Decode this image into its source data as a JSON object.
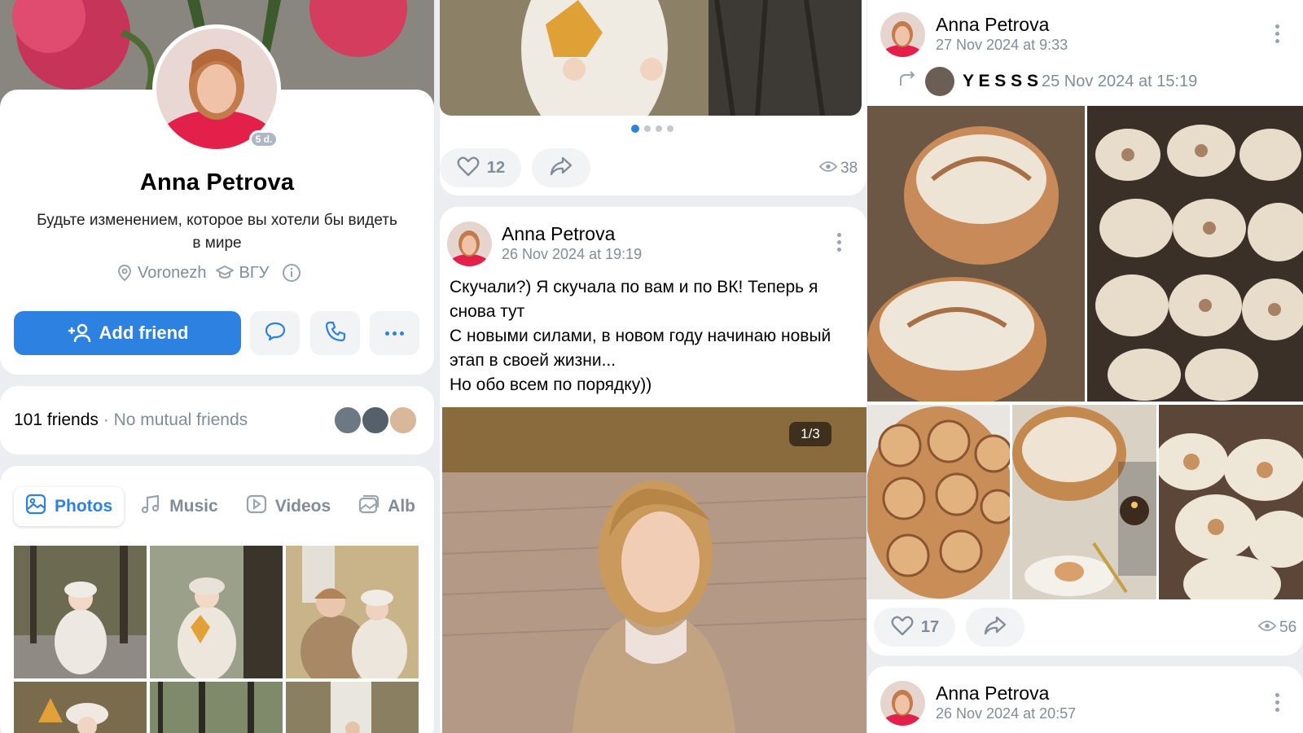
{
  "profile": {
    "name": "Anna Petrova",
    "online_badge": "5 d.",
    "status": "Будьте изменением, которое вы хотели бы видеть в мире",
    "city": "Voronezh",
    "university": "ВГУ",
    "add_friend_label": "Add friend",
    "friends_count": "101 friends",
    "mutual": "No mutual friends",
    "tabs": [
      {
        "label": "Photos",
        "icon": "photo-icon",
        "active": true
      },
      {
        "label": "Music",
        "icon": "music-icon",
        "active": false
      },
      {
        "label": "Videos",
        "icon": "video-icon",
        "active": false
      },
      {
        "label": "Alb",
        "icon": "album-icon",
        "active": false
      }
    ]
  },
  "post_top": {
    "carousel_total": 4,
    "carousel_active": 1,
    "likes": "12",
    "views": "38"
  },
  "post1": {
    "author": "Anna Petrova",
    "date": "26 Nov 2024 at 19:19",
    "text": "Скучали?) Я скучала по вам и по ВК! Теперь я снова тут\n С новыми силами, в новом году начинаю новый этап в своей жизни...\n Но обо всем по порядку))",
    "counter": "1/3"
  },
  "post2": {
    "author": "Anna Petrova",
    "date": "27 Nov 2024 at 9:33",
    "repost_author": "Y E S S S",
    "repost_date": "25 Nov 2024 at 15:19",
    "likes": "17",
    "views": "56"
  },
  "post3": {
    "author": "Anna Petrova",
    "date": "26 Nov 2024 at 20:57"
  },
  "colors": {
    "accent": "#2d81e0",
    "text_secondary": "#818c99",
    "button_bg": "#f2f3f5"
  }
}
